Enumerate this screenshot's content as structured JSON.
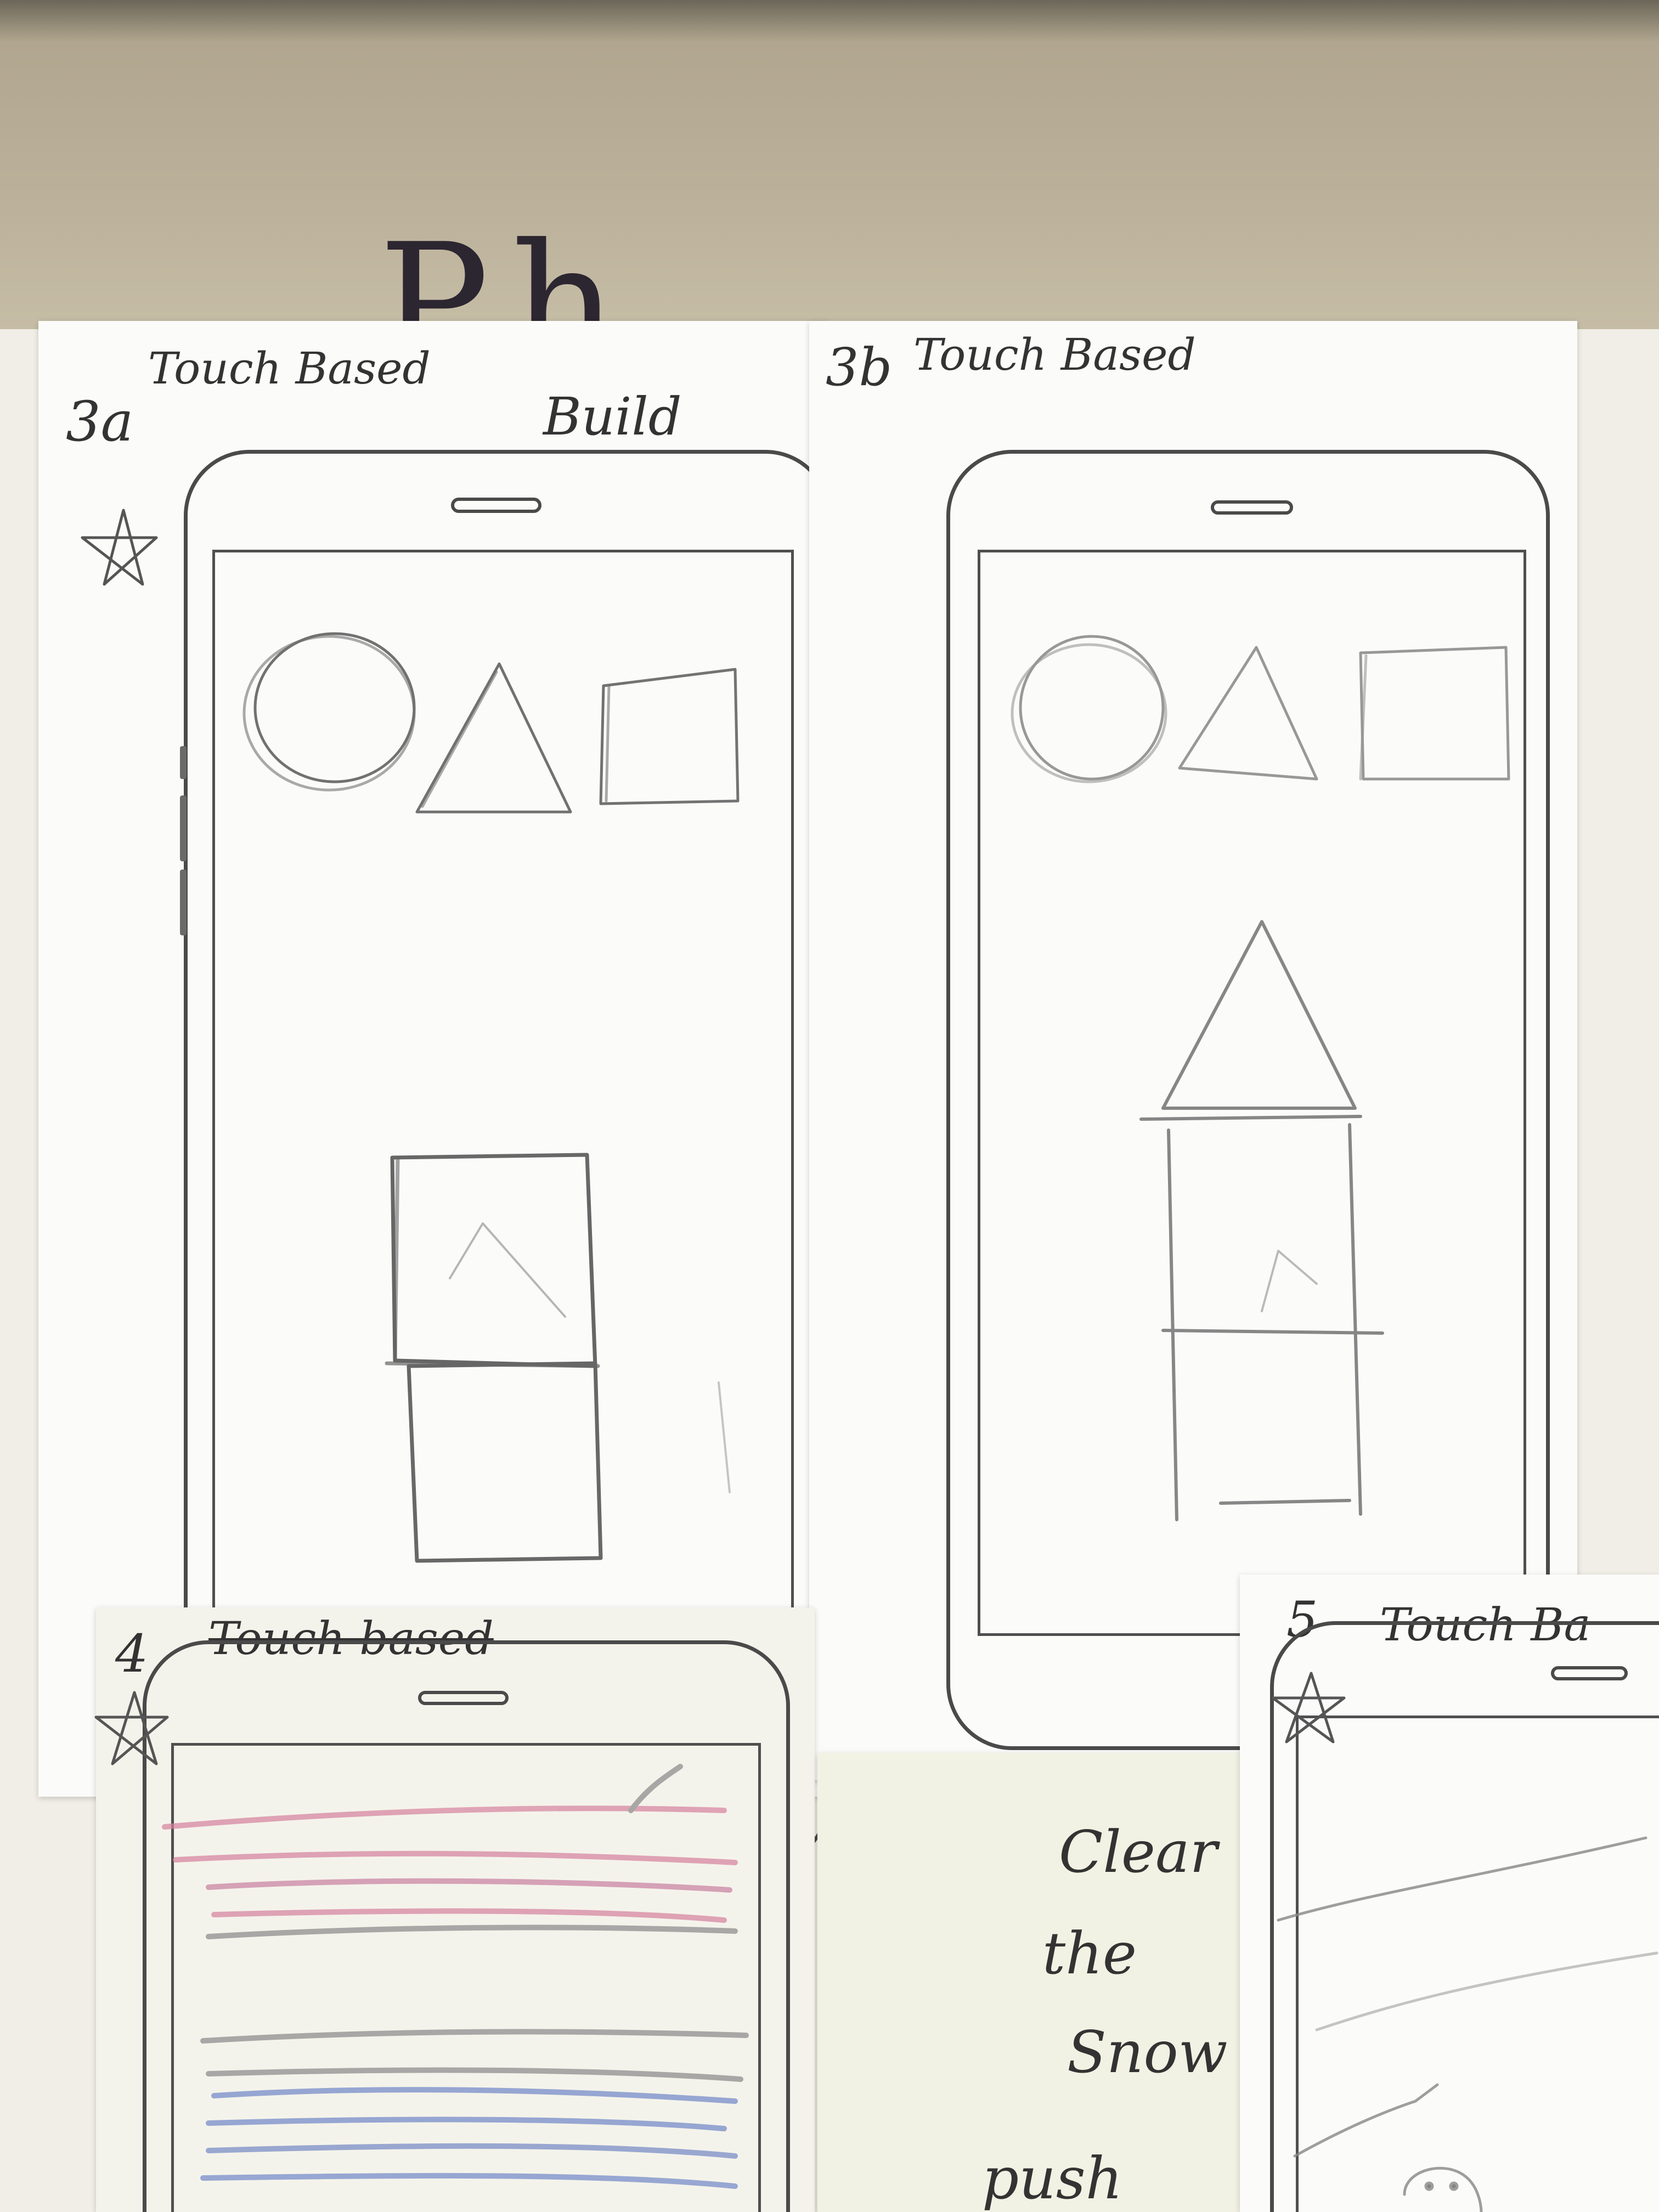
{
  "folder": {
    "label": "Ph"
  },
  "sketch_3a": {
    "number": "3a",
    "title": "Touch Based",
    "note": "Build"
  },
  "sketch_3b": {
    "number": "3b",
    "title": "Touch Based"
  },
  "sketch_4": {
    "number": "4",
    "title": "Touch based"
  },
  "sticky_note": {
    "line1": "Clear",
    "line2": "the",
    "line3": "Snow",
    "line4": "push"
  },
  "sketch_5": {
    "number": "5",
    "title": "Touch Ba"
  },
  "colors": {
    "pink_scribble": "#d6819e",
    "blue_scribble": "#6f86c8",
    "pencil": "#555555",
    "phone_outline": "#4a4a4a"
  }
}
